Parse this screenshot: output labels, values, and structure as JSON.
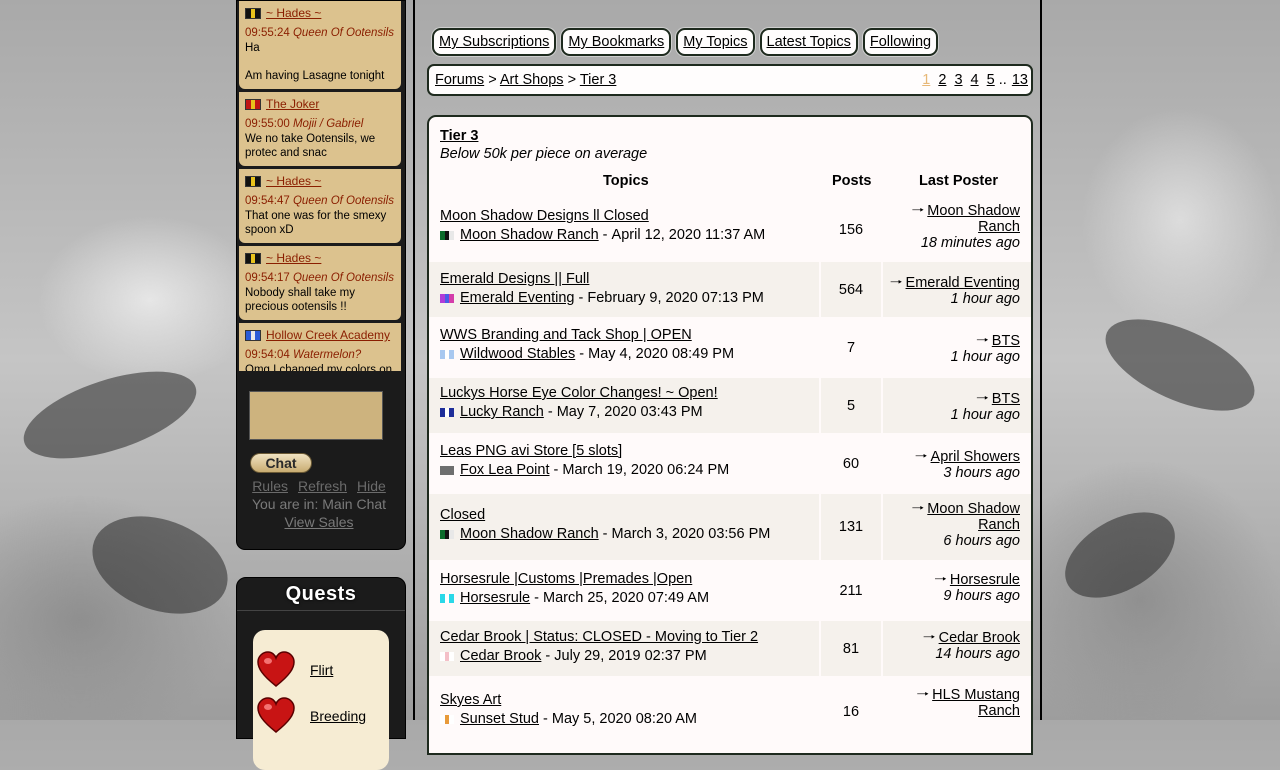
{
  "chat": {
    "messages": [
      {
        "user": "~ Hades ~",
        "flag": [
          "#111111",
          "#e8c21c",
          "#111111"
        ],
        "time": "09:55:24",
        "alias": "Queen Of Ootensils",
        "text": "Ha\n\nAm having Lasagne tonight"
      },
      {
        "user": "The Joker",
        "flag": [
          "#c01515",
          "#e8c21c",
          "#c01515"
        ],
        "time": "09:55:00",
        "alias": "Mojii / Gabriel",
        "text": "We no take Ootensils, we protec and snac"
      },
      {
        "user": "~ Hades ~",
        "flag": [
          "#111111",
          "#e8c21c",
          "#111111"
        ],
        "time": "09:54:47",
        "alias": "Queen Of Ootensils",
        "text": "That one was for the smexy spoon xD"
      },
      {
        "user": "~ Hades ~",
        "flag": [
          "#111111",
          "#e8c21c",
          "#111111"
        ],
        "time": "09:54:17",
        "alias": "Queen Of Ootensils",
        "text": "Nobody shall take my precious ootensils !!"
      },
      {
        "user": "Hollow Creek Academy",
        "flag": [
          "#2a5bd6",
          "#e8e8e8",
          "#2a5bd6"
        ],
        "time": "09:54:04",
        "alias": "Watermelon?",
        "text": "Omg I changed my colors on"
      }
    ],
    "send_label": "Chat",
    "links": {
      "rules": "Rules",
      "refresh": "Refresh",
      "hide": "Hide"
    },
    "location": "You are in: Main Chat",
    "view_sales": "View Sales"
  },
  "quests": {
    "title": "Quests",
    "items": [
      {
        "label": "Flirt"
      },
      {
        "label": "Breeding"
      }
    ],
    "heart_color": "#c81414"
  },
  "tabs": [
    "My Subscriptions",
    "My Bookmarks",
    "My Topics",
    "Latest Topics",
    "Following"
  ],
  "breadcrumb": {
    "forums": "Forums",
    "sep": ">",
    "art_shops": "Art Shops",
    "tier": "Tier 3"
  },
  "pager": {
    "pages": [
      "1",
      "2",
      "3",
      "4",
      "5"
    ],
    "ellipsis": "..",
    "last": "13",
    "current": "1"
  },
  "forum": {
    "title": "Tier 3",
    "subtitle": "Below 50k per piece on average",
    "headers": {
      "topics": "Topics",
      "posts": "Posts",
      "last_poster": "Last Poster"
    },
    "topics": [
      {
        "title": "Moon Shadow Designs ll Closed",
        "author": "Moon Shadow Ranch",
        "date": "April 12, 2020 11:37 AM",
        "posts": "156",
        "last_poster": "Moon Shadow Ranch",
        "ago": "18 minutes ago",
        "flag": [
          "#0a6a2a",
          "#111111",
          "#e8e8e8"
        ]
      },
      {
        "title": "Emerald Designs || Full",
        "author": "Emerald Eventing",
        "date": "February 9, 2020 07:13 PM",
        "posts": "564",
        "last_poster": "Emerald Eventing",
        "ago": "1 hour ago",
        "flag": [
          "#b03cd8",
          "#4a5ce6",
          "#d43caa"
        ]
      },
      {
        "title": "WWS Branding and Tack Shop | OPEN",
        "author": "Wildwood Stables",
        "date": "May 4, 2020 08:49 PM",
        "posts": "7",
        "last_poster": "BTS",
        "ago": "1 hour ago",
        "flag": [
          "#a8c8f0",
          "#ffffff",
          "#a8c8f0"
        ]
      },
      {
        "title": "Luckys Horse Eye Color Changes! ~ Open!",
        "author": "Lucky Ranch",
        "date": "May 7, 2020 03:43 PM",
        "posts": "5",
        "last_poster": "BTS",
        "ago": "1 hour ago",
        "flag": [
          "#1e2e9a",
          "#ffffff",
          "#1e2e9a"
        ]
      },
      {
        "title": "Leas PNG avi Store [5 slots]",
        "author": "Fox Lea Point",
        "date": "March 19, 2020 06:24 PM",
        "posts": "60",
        "last_poster": "April Showers",
        "ago": "3 hours ago",
        "flag": [
          "#6e6e6e",
          "#6e6e6e",
          "#6e6e6e"
        ]
      },
      {
        "title": "Closed",
        "author": "Moon Shadow Ranch",
        "date": "March 3, 2020 03:56 PM",
        "posts": "131",
        "last_poster": "Moon Shadow Ranch",
        "ago": "6 hours ago",
        "flag": [
          "#0a6a2a",
          "#111111",
          "#e8e8e8"
        ]
      },
      {
        "title": "Horsesrule |Customs |Premades |Open",
        "author": "Horsesrule",
        "date": "March 25, 2020 07:49 AM",
        "posts": "211",
        "last_poster": "Horsesrule",
        "ago": "9 hours ago",
        "flag": [
          "#2ad8e8",
          "#ffffff",
          "#2ad8e8"
        ]
      },
      {
        "title": "Cedar Brook | Status: CLOSED - Moving to Tier 2",
        "author": "Cedar Brook",
        "date": "July 29, 2019 02:37 PM",
        "posts": "81",
        "last_poster": "Cedar Brook",
        "ago": "14 hours ago",
        "flag": [
          "#ffffff",
          "#f4c0c8",
          "#ffffff"
        ]
      },
      {
        "title": "Skyes Art",
        "author": "Sunset Stud",
        "date": "May 5, 2020 08:20 AM",
        "posts": "16",
        "last_poster": "HLS Mustang Ranch",
        "ago": "",
        "flag": [
          "#ffffff",
          "#e89a3a",
          "#ffffff"
        ]
      }
    ]
  }
}
